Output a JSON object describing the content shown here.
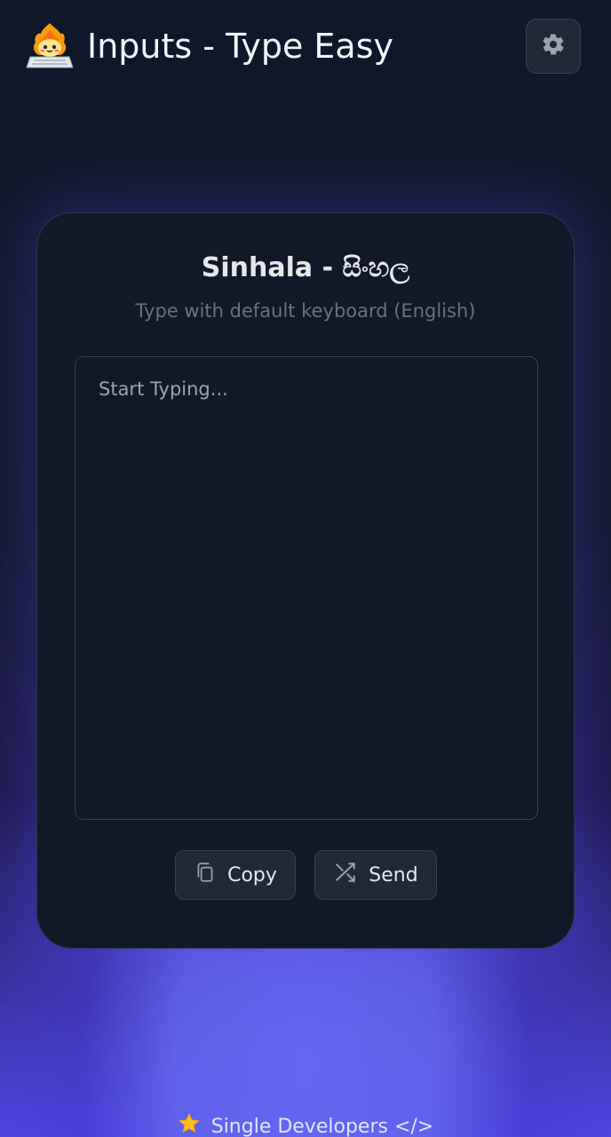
{
  "header": {
    "title": "Inputs - Type Easy",
    "logo_icon": "laptop-flame-mascot-icon",
    "settings_icon": "gear-icon"
  },
  "card": {
    "title": "Sinhala - සිංහල",
    "subtitle": "Type with default keyboard (English)",
    "input": {
      "placeholder": "Start Typing...",
      "value": ""
    },
    "buttons": {
      "copy_label": "Copy",
      "copy_icon": "copy-icon",
      "send_label": "Send",
      "send_icon": "shuffle-icon"
    }
  },
  "footer": {
    "icon": "star-icon",
    "text": "Single Developers </>"
  },
  "colors": {
    "background": "#111827",
    "accent": "#6366f1",
    "card_border": "#2d3748",
    "button_bg": "#1f2937"
  }
}
